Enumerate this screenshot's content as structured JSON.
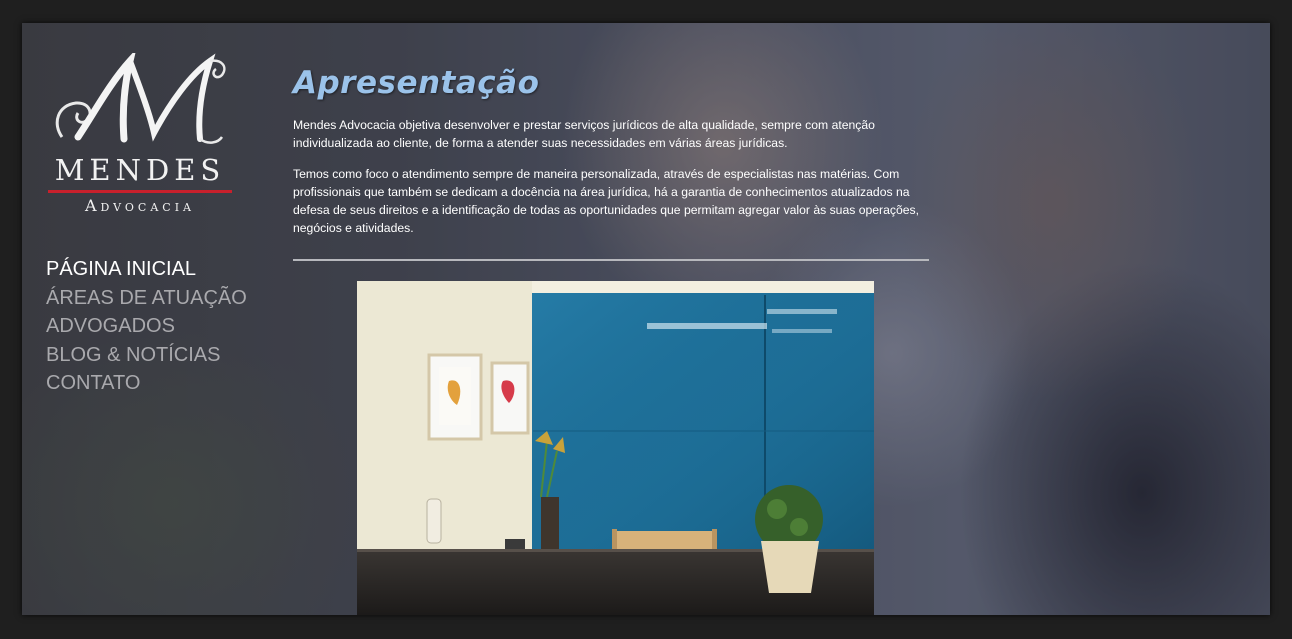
{
  "brand": {
    "monogram": "M",
    "name": "MENDES",
    "subtitle": "Advocacia",
    "accent_color": "#c8202c"
  },
  "nav": {
    "items": [
      {
        "label": "PÁGINA INICIAL",
        "active": true
      },
      {
        "label": "ÁREAS DE ATUAÇÃO",
        "active": false
      },
      {
        "label": "ADVOGADOS",
        "active": false
      },
      {
        "label": "BLOG & NOTÍCIAS",
        "active": false
      },
      {
        "label": "CONTATO",
        "active": false
      }
    ]
  },
  "main": {
    "title": "Apresentação",
    "title_color": "#9bc3ea",
    "paragraphs": [
      "Mendes Advocacia objetiva desenvolver e prestar serviços jurídicos de alta qualidade, sempre com atenção individualizada ao cliente, de forma a atender suas necessidades em várias áreas jurídicas.",
      "Temos como foco o atendimento sempre de maneira personalizada, através de especialistas nas matérias. Com profissionais que também se dedicam a docência na área jurídica, há a garantia de conhecimentos atualizados na defesa de seus direitos e a identificação de todas as oportunidades que permitam agregar valor às suas operações, negócios e atividades."
    ]
  }
}
